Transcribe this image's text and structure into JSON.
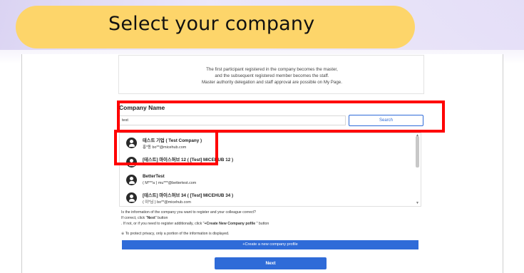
{
  "slide": {
    "title": "Select your company"
  },
  "notice": {
    "lines": [
      "The first participant registered in the company becomes the master,",
      "and the subsequent registered member becomes the staff.",
      "Master authority delegation and staff approval are possible on My Page."
    ]
  },
  "search": {
    "label": "Company Name",
    "value": "test",
    "button_label": "Search"
  },
  "results": [
    {
      "name": "테스트 기업 ( Test Company )",
      "contact": "홍*동   bo**@micehub.com"
    },
    {
      "name": "[테스트] 마이스허브 12 ( [Test] MICEHUB 12 )",
      "contact": ""
    },
    {
      "name": "BetterTest",
      "contact": "( M***a )  mu***@bettertest.com"
    },
    {
      "name": "[테스트] 마이스허브 34 ( [Test] MICEHUB 34 )",
      "contact": "( 이*님 )  bo**@micehub.com"
    }
  ],
  "info": {
    "line1": "Is the information of the company you want to register and your colleague correct?",
    "line2_prefix": "If correct, click \"",
    "line2_bold": "Next",
    "line2_suffix": "\" button",
    "line3_prefix": ". If not, or if you need to register additionally, click \"",
    "line3_bold": "+Create New Company pofile",
    "line3_suffix": " \" button",
    "line4": "※ To protect privacy, only a portion of the information is displayed."
  },
  "actions": {
    "create_label": "+Create a new company profile",
    "next_label": "Next"
  },
  "colors": {
    "accent": "#2f6bd8",
    "title_pill": "#fdd56a",
    "highlight": "#ff0000"
  }
}
